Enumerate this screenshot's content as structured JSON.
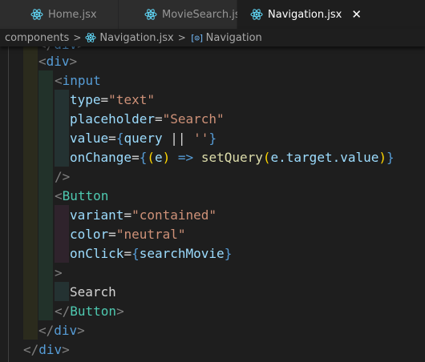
{
  "tabs": [
    {
      "label": "Home.jsx",
      "icon": "react-icon",
      "active": false
    },
    {
      "label": "MovieSearch.jsx",
      "icon": "react-icon",
      "active": false
    },
    {
      "label": "Navigation.jsx",
      "icon": "react-icon",
      "active": true,
      "close": "✕"
    }
  ],
  "breadcrumb": {
    "folder": "components",
    "file": "Navigation.jsx",
    "symbol": "Navigation",
    "separator": ">"
  },
  "code": {
    "div_open": "div",
    "input_tag": "input",
    "attr_type": "type",
    "val_type": "\"text\"",
    "attr_placeholder": "placeholder",
    "val_placeholder": "\"Search\"",
    "attr_value": "value",
    "val_query": "query",
    "val_or": "||",
    "val_empty": "''",
    "attr_onchange": "onChange",
    "val_e": "e",
    "val_arrow": "=>",
    "fn_setquery": "setQuery",
    "val_target": "e.target.value",
    "button_tag": "Button",
    "attr_variant": "variant",
    "val_variant": "\"contained\"",
    "attr_color": "color",
    "val_color": "\"neutral\"",
    "attr_onclick": "onClick",
    "val_onclick": "searchMovie",
    "text_search": "Search",
    "button_close": "Button",
    "div_close_inner": "div",
    "div_close_outer": "div"
  },
  "colors": {
    "editor_bg": "#1e1e1e",
    "tag": "#569cd6",
    "component": "#4ec9b0",
    "attribute": "#9cdcfe",
    "string": "#ce9178",
    "function": "#dcdcaa",
    "react_icon": "#61dafb"
  }
}
